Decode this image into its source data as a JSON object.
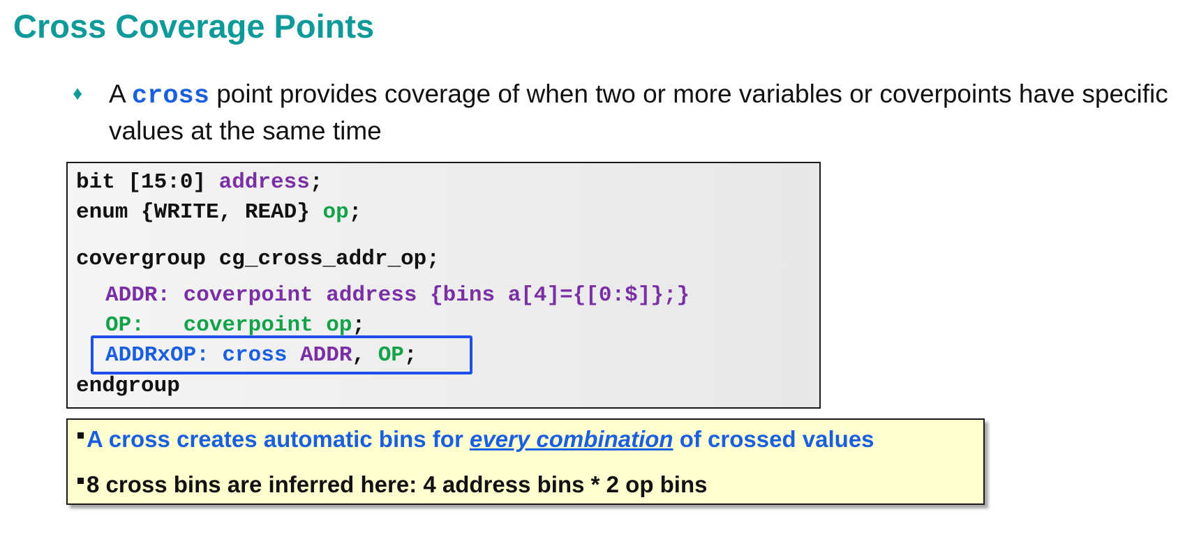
{
  "slide": {
    "title": "Cross Coverage Points"
  },
  "bullet": {
    "marker": "♦",
    "prefix": "A ",
    "keyword": "cross",
    "suffix": " point provides coverage of when two or more variables or coverpoints have specific values at the same time"
  },
  "code": {
    "line1": {
      "a": "bit [15:0] ",
      "b": "address",
      "c": ";"
    },
    "line2": {
      "a": "enum {WRITE, READ} ",
      "b": "op",
      "c": ";"
    },
    "line3": {
      "a": "covergroup cg_cross_addr_op;"
    },
    "line4": {
      "a": "ADDR: coverpoint address {bins a[4]={[0:$]};}"
    },
    "line5": {
      "a": "OP:   coverpoint op",
      "b": ";"
    },
    "line6": {
      "a": "ADDRxOP: cross ",
      "b": "ADDR",
      "c": ", ",
      "d": "OP",
      "e": ";"
    },
    "line7": {
      "a": "endgroup"
    }
  },
  "notes": {
    "line1": {
      "before": "A cross creates automatic bins for ",
      "emphasis": "every combination",
      "after": " of crossed values"
    },
    "line2": {
      "text": "8 cross bins are inferred here: 4 address bins * 2 op bins"
    }
  },
  "colors": {
    "title": "#0f9a9a",
    "keyword_blue": "#1a5fe0",
    "purple": "#7a2fa5",
    "green": "#12a34a",
    "highlight_border": "#1f4fe6",
    "note_background": "#ffffcf"
  }
}
